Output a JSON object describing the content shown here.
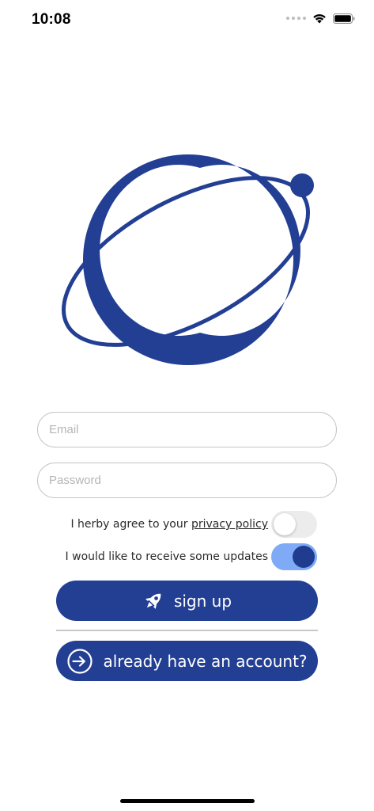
{
  "status_bar": {
    "time": "10:08"
  },
  "form": {
    "email_placeholder": "Email",
    "password_placeholder": "Password"
  },
  "toggles": {
    "privacy": {
      "text": "I herby agree to your",
      "link": "privacy policy",
      "on": false
    },
    "updates": {
      "text": "I would like to receive some updates",
      "on": true
    }
  },
  "buttons": {
    "signup_label": "sign up",
    "signup_icon": "rocket-icon",
    "login_label": "already have an account?",
    "login_icon": "sign-in-icon"
  },
  "colors": {
    "brand_blue": "#233f94",
    "toggle_on_track": "#7faaf6",
    "toggle_on_knob": "#1f3c8f",
    "toggle_off_track": "#ececec"
  }
}
